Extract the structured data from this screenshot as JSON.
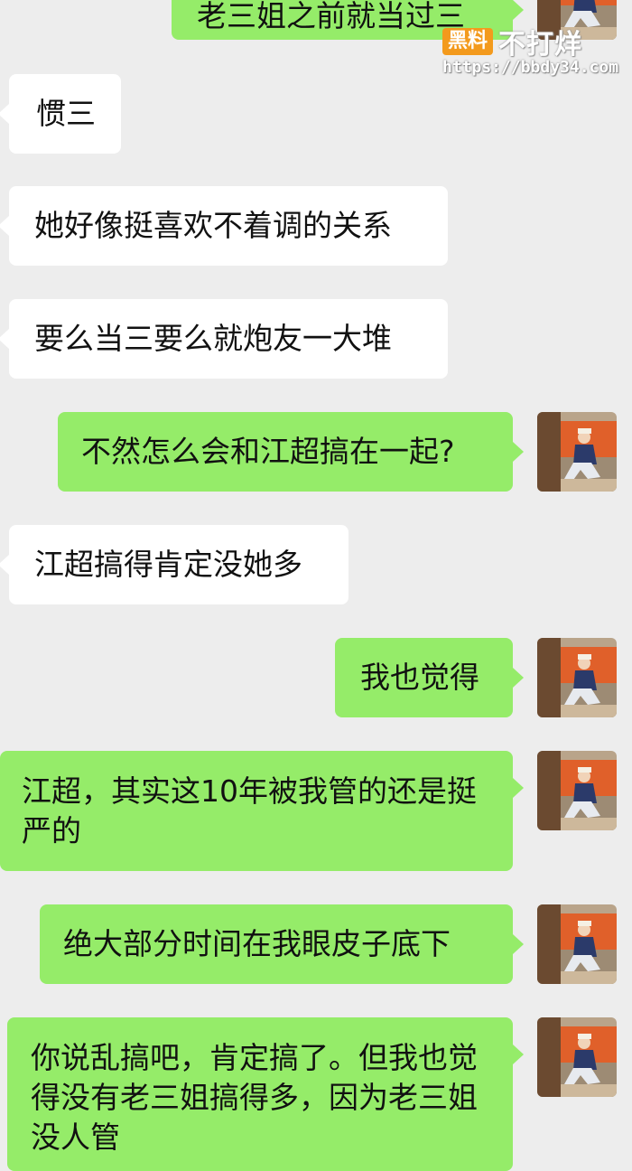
{
  "watermark": {
    "badge": "黑料",
    "brand": "不打烊",
    "url": "https://bbdy34.com"
  },
  "messages": [
    {
      "side": "out",
      "text": "老三姐之前就当过三",
      "partial": "top-clipped"
    },
    {
      "side": "in",
      "text": "惯三"
    },
    {
      "side": "in",
      "text": "她好像挺喜欢不着调的关系"
    },
    {
      "side": "in",
      "text": "要么当三要么就炮友一大堆"
    },
    {
      "side": "out",
      "text": "不然怎么会和江超搞在一起?"
    },
    {
      "side": "in",
      "text": "江超搞得肯定没她多"
    },
    {
      "side": "out",
      "text": "我也觉得"
    },
    {
      "side": "out",
      "text": "江超，其实这10年被我管的还是挺严的"
    },
    {
      "side": "out",
      "text": "绝大部分时间在我眼皮子底下"
    },
    {
      "side": "out",
      "text": "你说乱搞吧，肯定搞了。但我也觉得没有老三姐搞得多，因为老三姐没人管"
    }
  ],
  "colors": {
    "background": "#ededed",
    "incoming_bubble": "#ffffff",
    "outgoing_bubble": "#95ec69",
    "watermark_badge": "#f39a1d"
  },
  "icons": {
    "avatar": "user-photo-avatar"
  }
}
